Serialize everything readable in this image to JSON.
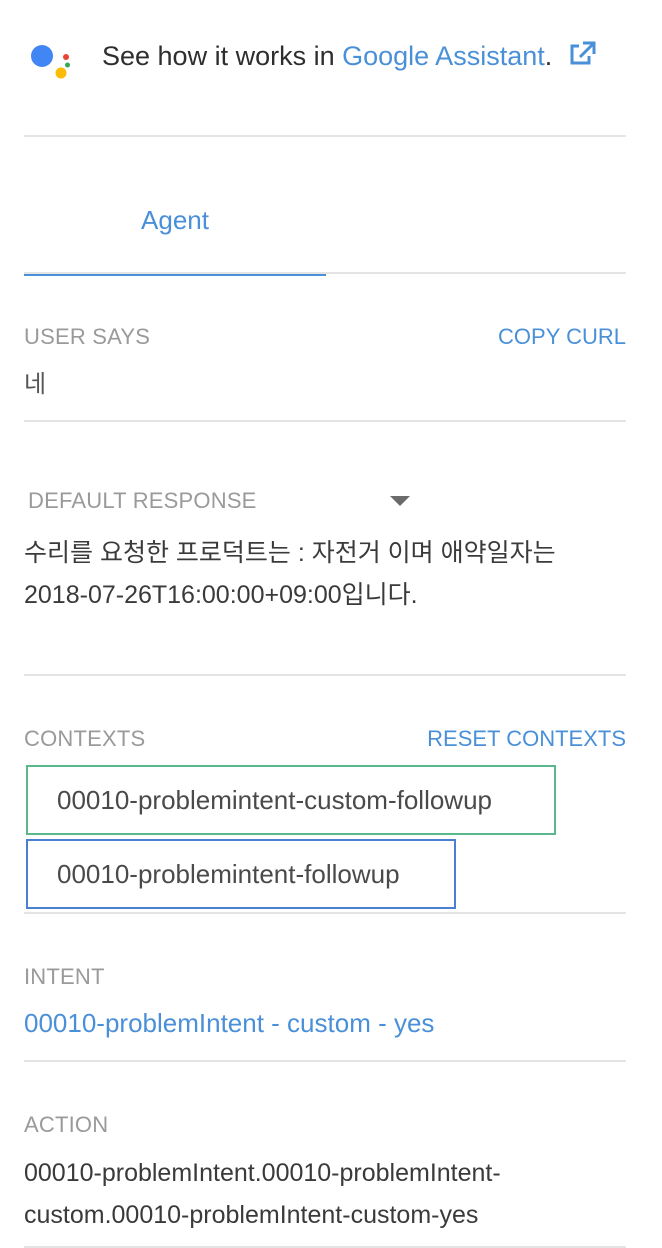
{
  "assistant": {
    "prefix": "See how it works in ",
    "link": "Google Assistant",
    "suffix": ".",
    "icon": "external-link-icon"
  },
  "tabs": [
    {
      "label": "Agent",
      "active": true
    }
  ],
  "user_says": {
    "label": "USER SAYS",
    "action": "COPY CURL",
    "value": "네"
  },
  "default_response": {
    "label": "DEFAULT RESPONSE",
    "icon": "caret-down-icon",
    "text": "수리를 요청한 프로덕트는 : 자전거 이며 애약일자는 2018-07-26T16:00:00+09:00입니다."
  },
  "contexts": {
    "label": "CONTEXTS",
    "action": "RESET CONTEXTS",
    "items": [
      "00010-problemintent-custom-followup",
      "00010-problemintent-followup"
    ]
  },
  "intent": {
    "label": "INTENT",
    "value": "00010-problemIntent - custom - yes"
  },
  "action": {
    "label": "ACTION",
    "value": "00010-problemIntent.00010-problemIntent-custom.00010-problemIntent-custom-yes"
  },
  "colors": {
    "accent": "#4a90d9",
    "context_1": "#5bb88d",
    "context_2": "#4a7fd1",
    "assistant_blue": "#4285f4",
    "assistant_red": "#ea4335",
    "assistant_yellow": "#fbbc05",
    "assistant_green": "#34a853"
  }
}
